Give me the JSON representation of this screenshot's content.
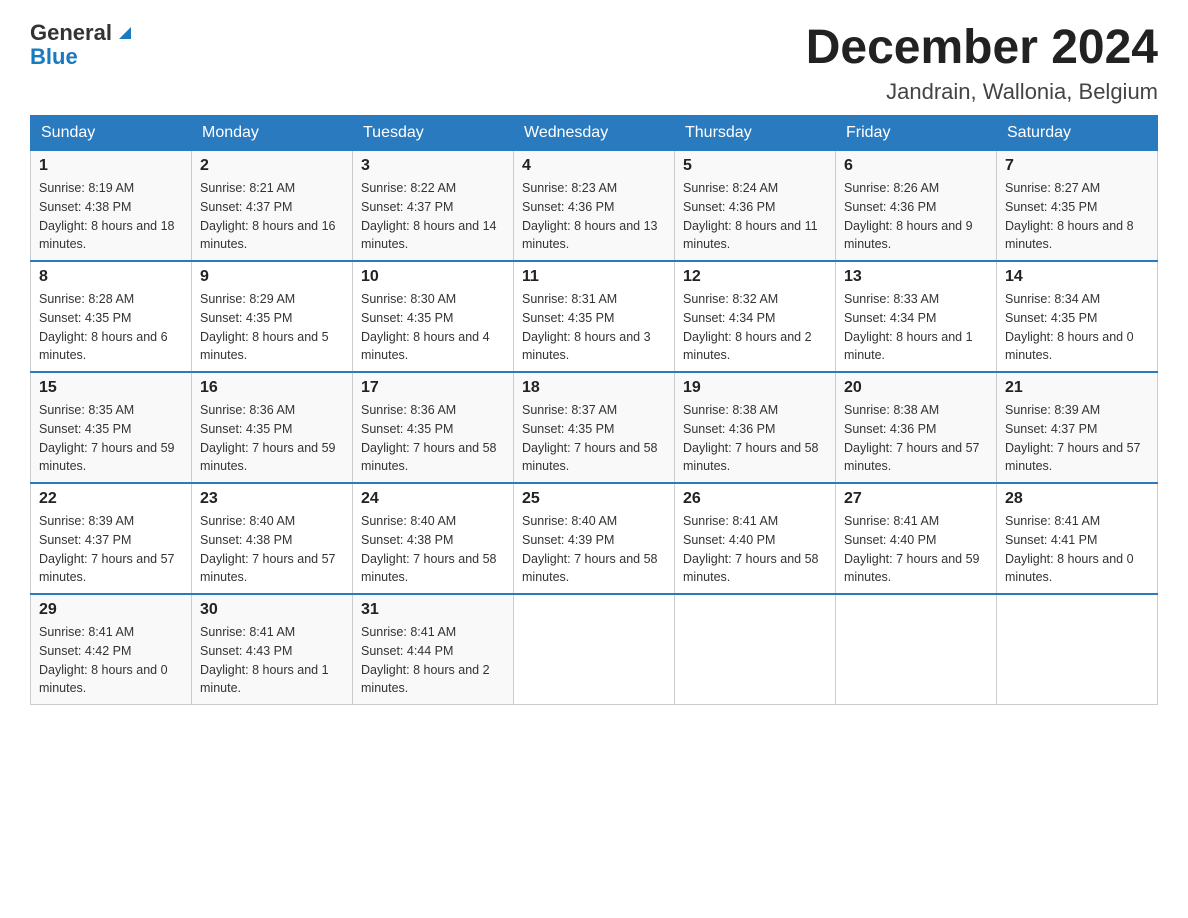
{
  "logo": {
    "general": "General",
    "blue": "Blue"
  },
  "title": "December 2024",
  "subtitle": "Jandrain, Wallonia, Belgium",
  "days_header": [
    "Sunday",
    "Monday",
    "Tuesday",
    "Wednesday",
    "Thursday",
    "Friday",
    "Saturday"
  ],
  "weeks": [
    [
      {
        "day": "1",
        "sunrise": "8:19 AM",
        "sunset": "4:38 PM",
        "daylight": "8 hours and 18 minutes."
      },
      {
        "day": "2",
        "sunrise": "8:21 AM",
        "sunset": "4:37 PM",
        "daylight": "8 hours and 16 minutes."
      },
      {
        "day": "3",
        "sunrise": "8:22 AM",
        "sunset": "4:37 PM",
        "daylight": "8 hours and 14 minutes."
      },
      {
        "day": "4",
        "sunrise": "8:23 AM",
        "sunset": "4:36 PM",
        "daylight": "8 hours and 13 minutes."
      },
      {
        "day": "5",
        "sunrise": "8:24 AM",
        "sunset": "4:36 PM",
        "daylight": "8 hours and 11 minutes."
      },
      {
        "day": "6",
        "sunrise": "8:26 AM",
        "sunset": "4:36 PM",
        "daylight": "8 hours and 9 minutes."
      },
      {
        "day": "7",
        "sunrise": "8:27 AM",
        "sunset": "4:35 PM",
        "daylight": "8 hours and 8 minutes."
      }
    ],
    [
      {
        "day": "8",
        "sunrise": "8:28 AM",
        "sunset": "4:35 PM",
        "daylight": "8 hours and 6 minutes."
      },
      {
        "day": "9",
        "sunrise": "8:29 AM",
        "sunset": "4:35 PM",
        "daylight": "8 hours and 5 minutes."
      },
      {
        "day": "10",
        "sunrise": "8:30 AM",
        "sunset": "4:35 PM",
        "daylight": "8 hours and 4 minutes."
      },
      {
        "day": "11",
        "sunrise": "8:31 AM",
        "sunset": "4:35 PM",
        "daylight": "8 hours and 3 minutes."
      },
      {
        "day": "12",
        "sunrise": "8:32 AM",
        "sunset": "4:34 PM",
        "daylight": "8 hours and 2 minutes."
      },
      {
        "day": "13",
        "sunrise": "8:33 AM",
        "sunset": "4:34 PM",
        "daylight": "8 hours and 1 minute."
      },
      {
        "day": "14",
        "sunrise": "8:34 AM",
        "sunset": "4:35 PM",
        "daylight": "8 hours and 0 minutes."
      }
    ],
    [
      {
        "day": "15",
        "sunrise": "8:35 AM",
        "sunset": "4:35 PM",
        "daylight": "7 hours and 59 minutes."
      },
      {
        "day": "16",
        "sunrise": "8:36 AM",
        "sunset": "4:35 PM",
        "daylight": "7 hours and 59 minutes."
      },
      {
        "day": "17",
        "sunrise": "8:36 AM",
        "sunset": "4:35 PM",
        "daylight": "7 hours and 58 minutes."
      },
      {
        "day": "18",
        "sunrise": "8:37 AM",
        "sunset": "4:35 PM",
        "daylight": "7 hours and 58 minutes."
      },
      {
        "day": "19",
        "sunrise": "8:38 AM",
        "sunset": "4:36 PM",
        "daylight": "7 hours and 58 minutes."
      },
      {
        "day": "20",
        "sunrise": "8:38 AM",
        "sunset": "4:36 PM",
        "daylight": "7 hours and 57 minutes."
      },
      {
        "day": "21",
        "sunrise": "8:39 AM",
        "sunset": "4:37 PM",
        "daylight": "7 hours and 57 minutes."
      }
    ],
    [
      {
        "day": "22",
        "sunrise": "8:39 AM",
        "sunset": "4:37 PM",
        "daylight": "7 hours and 57 minutes."
      },
      {
        "day": "23",
        "sunrise": "8:40 AM",
        "sunset": "4:38 PM",
        "daylight": "7 hours and 57 minutes."
      },
      {
        "day": "24",
        "sunrise": "8:40 AM",
        "sunset": "4:38 PM",
        "daylight": "7 hours and 58 minutes."
      },
      {
        "day": "25",
        "sunrise": "8:40 AM",
        "sunset": "4:39 PM",
        "daylight": "7 hours and 58 minutes."
      },
      {
        "day": "26",
        "sunrise": "8:41 AM",
        "sunset": "4:40 PM",
        "daylight": "7 hours and 58 minutes."
      },
      {
        "day": "27",
        "sunrise": "8:41 AM",
        "sunset": "4:40 PM",
        "daylight": "7 hours and 59 minutes."
      },
      {
        "day": "28",
        "sunrise": "8:41 AM",
        "sunset": "4:41 PM",
        "daylight": "8 hours and 0 minutes."
      }
    ],
    [
      {
        "day": "29",
        "sunrise": "8:41 AM",
        "sunset": "4:42 PM",
        "daylight": "8 hours and 0 minutes."
      },
      {
        "day": "30",
        "sunrise": "8:41 AM",
        "sunset": "4:43 PM",
        "daylight": "8 hours and 1 minute."
      },
      {
        "day": "31",
        "sunrise": "8:41 AM",
        "sunset": "4:44 PM",
        "daylight": "8 hours and 2 minutes."
      },
      null,
      null,
      null,
      null
    ]
  ]
}
